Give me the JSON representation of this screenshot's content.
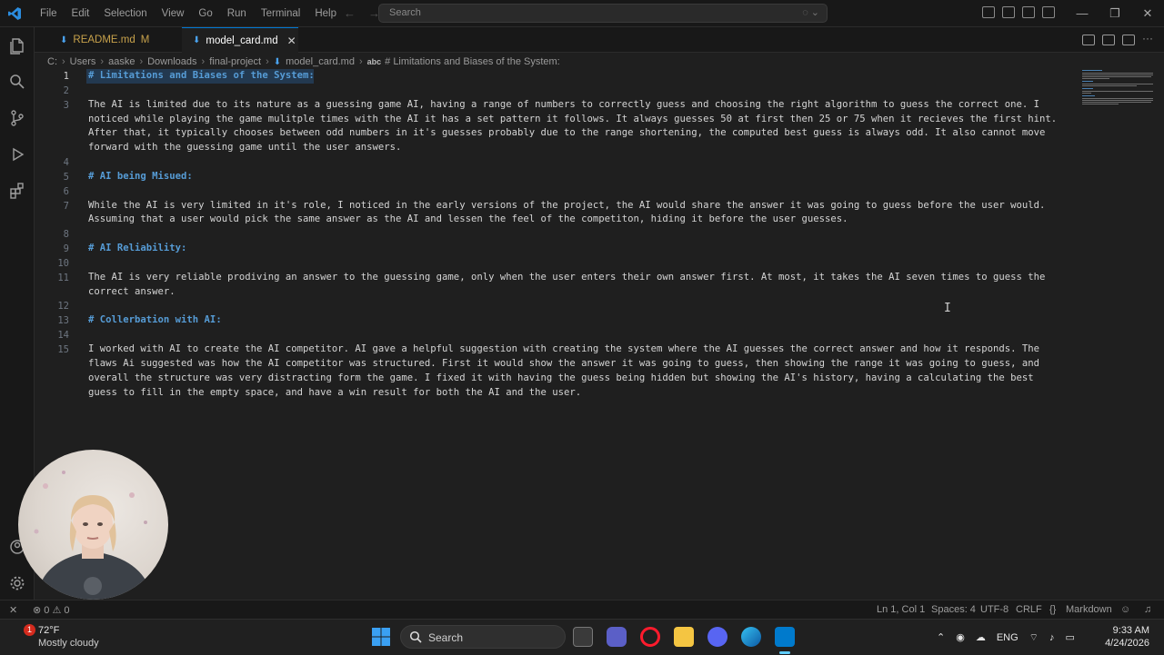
{
  "menu": [
    "File",
    "Edit",
    "Selection",
    "View",
    "Go",
    "Run",
    "Terminal",
    "Help"
  ],
  "command_center": {
    "placeholder": "Search"
  },
  "tabs": [
    {
      "label": "README.md",
      "badge": "M"
    },
    {
      "label": "model_card.md"
    }
  ],
  "breadcrumb": {
    "parts": [
      "C:",
      "Users",
      "aaske",
      "Downloads",
      "final-project",
      "model_card.md",
      "# Limitations and Biases of the System:"
    ]
  },
  "editor": {
    "line_numbers": [
      "1",
      "2",
      "3",
      "4",
      "5",
      "6",
      "7",
      "8",
      "9",
      "10",
      "11",
      "12",
      "13",
      "14",
      "15"
    ],
    "lines": {
      "l1": "# Limitations and Biases of the System:",
      "l3a": "The AI is limited due to its nature as a guessing game AI, having a range of numbers to correctly guess and choosing the right algorithm to guess the correct one. I",
      "l3b": "noticed while playing the game mulitple times with the AI it has a set pattern it follows. It always guesses 50 at first then 25 or 75 when it recieves the first hint.",
      "l3c": "After that, it typically chooses between odd numbers in it's guesses probably due to the range shortening, the computed best guess is always odd. It also cannot move",
      "l3d": "forward with the guessing game until the user answers.",
      "l5": "# AI being Misued:",
      "l7a": "While the AI is very limited in it's role, I noticed in the early versions of the project, the AI would share the answer it was going to guess before the user would.",
      "l7b": "Assuming that a user would pick the same answer as the AI and lessen the feel of the competiton, hiding it before the user guesses.",
      "l9": "# AI Reliability:",
      "l11a": "The AI is very reliable prodiving an answer to the guessing game, only when the user enters their own answer first. At most, it takes the AI seven times to guess the",
      "l11b": "correct answer.",
      "l13": "# Collerbation with AI:",
      "l15a": "I worked with AI to create the AI competitor. AI gave a helpful suggestion with creating the system where the AI guesses the correct answer and how it responds. The",
      "l15b": "flaws Ai suggested was how the AI competitor was structured. First it would show the answer it was going to guess, then showing the range it was going to guess, and",
      "l15c": "overall the structure was very distracting form the game. I fixed it with having the guess being hidden but showing the AI's history, having a calculating the best",
      "l15d": "guess to fill in the empty space, and have a win result for both the AI and the user."
    }
  },
  "statusbar": {
    "errors": "0",
    "warnings": "0",
    "position": "Ln 1, Col 1",
    "spaces": "Spaces: 4",
    "encoding": "UTF-8",
    "eol": "CRLF",
    "language": "Markdown"
  },
  "taskbar": {
    "weather_badge": "1",
    "temperature": "72°F",
    "condition": "Mostly cloudy",
    "search_label": "Search",
    "language": "ENG",
    "time": "9:33 AM",
    "date": "4/24/2026"
  },
  "colors": {
    "accent": "#0078d4",
    "heading": "#569cd6",
    "modified": "#c8a24b",
    "editor_bg": "#1f1f1f"
  }
}
